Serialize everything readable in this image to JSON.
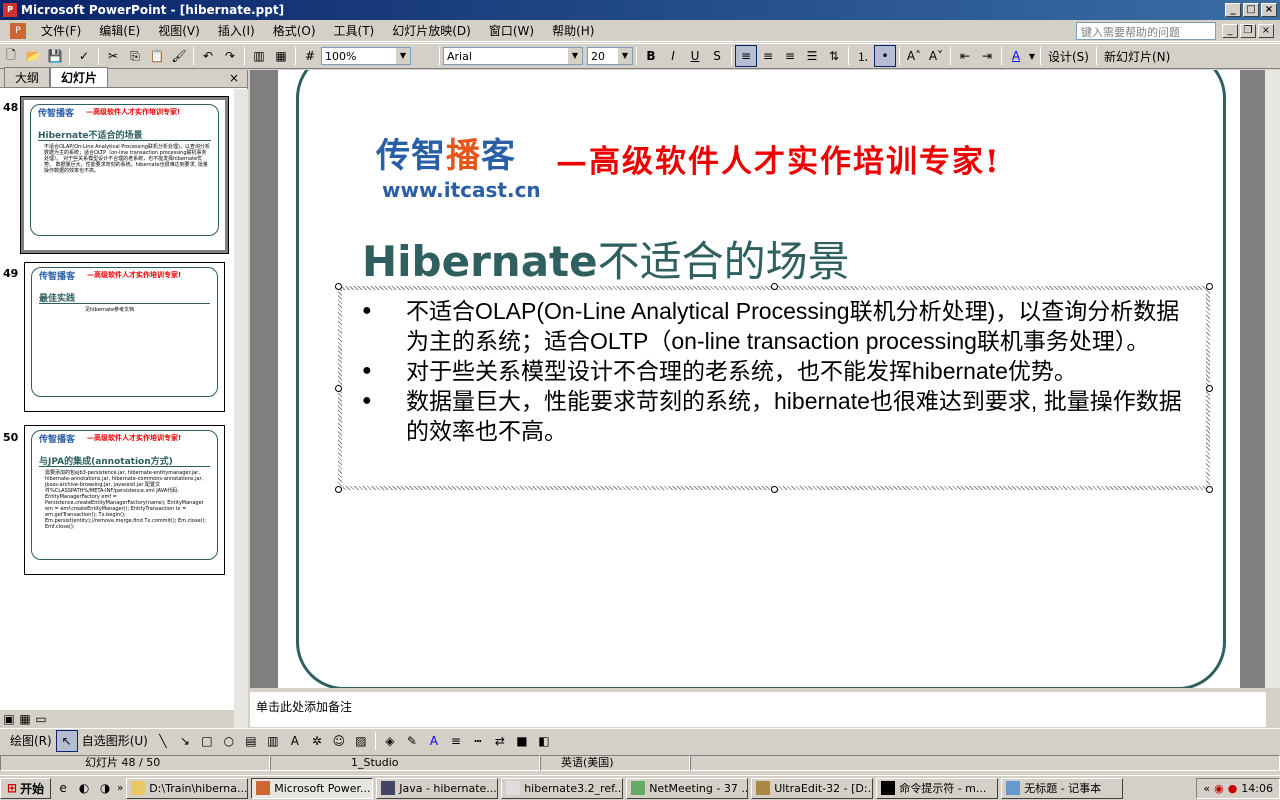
{
  "window": {
    "title": "Microsoft PowerPoint - [hibernate.ppt]"
  },
  "menu": {
    "items": [
      "文件(F)",
      "编辑(E)",
      "视图(V)",
      "插入(I)",
      "格式(O)",
      "工具(T)",
      "幻灯片放映(D)",
      "窗口(W)",
      "帮助(H)"
    ],
    "help_placeholder": "键入需要帮助的问题"
  },
  "toolbar": {
    "zoom": "100%",
    "font": "Arial",
    "size": "20",
    "design": "设计(S)",
    "new_slide": "新幻灯片(N)"
  },
  "panel": {
    "tabs": [
      "大纲",
      "幻灯片"
    ]
  },
  "thumbnails": [
    {
      "num": "48",
      "logo": "传智播客",
      "slogan": "—高级软件人才实作培训专家!",
      "title": "Hibernate不适合的场景",
      "body": "不适合OLAP(On-Line Analytical Processing联机分析处理)，以查询分析数据为主的系统；适合OLTP（on-line transaction processing联机事务处理）。 对于些关系模型设计不合理的老系统，也不能发挥hibernate优势。 数据量巨大，性能要求苛刻的系统，hibernate也很难达到要求, 批量操作数据的效率也不高。"
    },
    {
      "num": "49",
      "logo": "传智播客",
      "slogan": "—高级软件人才实作培训专家!",
      "title": "最佳实践",
      "body": "见hibernate参考文档"
    },
    {
      "num": "50",
      "logo": "传智播客",
      "slogan": "—高级软件人才实作培训专家!",
      "title": "与JPA的集成(annotation方式)",
      "body": "需要添加的包ejb3-persistence.jar, hibernate-entitymanager.jar, hibernate-annotations.jar, hibernate-commons-annotations.jar, jboss-archive-browsing.jar, javassist.jar 配置文件%CLASSPATH%/META-INF/persistence.xml JAVA代码: EntityManagerFactory emf = Persistence.createEntityManagerFactory(name); EntityManager em = emf.createEntityManager(); EntityTransaction tx = em.getTransaction(); Tx.begin(); Em.persist(entity);//remove,merge,find Tx.commit(); Em.close(); Emf.close();"
    }
  ],
  "slide": {
    "logo_text": "传智",
    "logo_red": "播",
    "logo_text2": "客",
    "logo_url": "www.itcast.cn",
    "slogan": "—高级软件人才实作培训专家!",
    "title_bold": "Hibernate",
    "title_rest": "不适合的场景",
    "bullets": [
      "不适合OLAP(On-Line Analytical Processing联机分析处理)，以查询分析数据为主的系统；适合OLTP（on-line transaction processing联机事务处理）。",
      "对于些关系模型设计不合理的老系统，也不能发挥hibernate优势。",
      "数据量巨大，性能要求苛刻的系统，hibernate也很难达到要求, 批量操作数据的效率也不高。"
    ]
  },
  "notes": {
    "placeholder": "单击此处添加备注"
  },
  "drawbar": {
    "draw": "绘图(R)",
    "autoshapes": "自选图形(U)"
  },
  "status": {
    "slide": "幻灯片 48 / 50",
    "template": "1_Studio",
    "lang": "英语(美国)"
  },
  "taskbar": {
    "start": "开始",
    "tasks": [
      "D:\\Train\\hiberna...",
      "Microsoft Power...",
      "Java - hibernate...",
      "hibernate3.2_ref...",
      "NetMeeting - 37 ...",
      "UltraEdit-32 - [D:...",
      "命令提示符 - m...",
      "无标题 - 记事本"
    ],
    "clock": "14:06"
  }
}
